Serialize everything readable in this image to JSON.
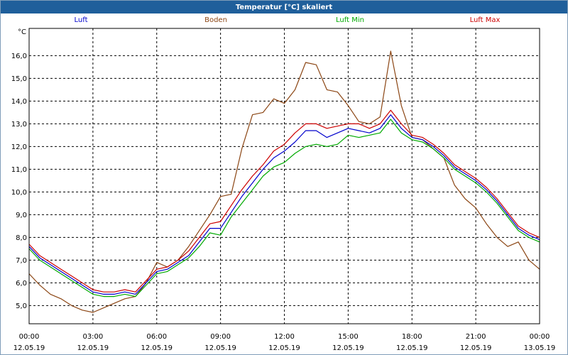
{
  "chart_data": {
    "type": "line",
    "title": "Temperatur [°C] skaliert",
    "yunit": "°C",
    "ylim": [
      4.2,
      17.2
    ],
    "yticks": [
      "5,0",
      "6,0",
      "7,0",
      "8,0",
      "9,0",
      "10,0",
      "11,0",
      "12,0",
      "13,0",
      "14,0",
      "15,0",
      "16,0"
    ],
    "yticks_values": [
      5,
      6,
      7,
      8,
      9,
      10,
      11,
      12,
      13,
      14,
      15,
      16
    ],
    "xlim": [
      0,
      24
    ],
    "xticks": [
      {
        "time": "00:00",
        "date": "12.05.19"
      },
      {
        "time": "03:00",
        "date": "12.05.19"
      },
      {
        "time": "06:00",
        "date": "12.05.19"
      },
      {
        "time": "09:00",
        "date": "12.05.19"
      },
      {
        "time": "12:00",
        "date": "12.05.19"
      },
      {
        "time": "15:00",
        "date": "12.05.19"
      },
      {
        "time": "18:00",
        "date": "12.05.19"
      },
      {
        "time": "21:00",
        "date": "12.05.19"
      },
      {
        "time": "00:00",
        "date": "13.05.19"
      }
    ],
    "grid": true,
    "series": [
      {
        "name": "Luft",
        "color": "#0000cc",
        "x": [
          0,
          0.5,
          1,
          1.5,
          2,
          2.5,
          3,
          3.5,
          4,
          4.5,
          5,
          5.5,
          6,
          6.5,
          7,
          7.5,
          8,
          8.5,
          9,
          9.5,
          10,
          10.5,
          11,
          11.5,
          12,
          12.5,
          13,
          13.5,
          14,
          14.5,
          15,
          15.5,
          16,
          16.5,
          17,
          17.5,
          18,
          18.5,
          19,
          19.5,
          20,
          20.5,
          21,
          21.5,
          22,
          22.5,
          23,
          23.5,
          24
        ],
        "values": [
          7.6,
          7.1,
          6.8,
          6.5,
          6.2,
          5.9,
          5.6,
          5.5,
          5.5,
          5.6,
          5.5,
          6.0,
          6.5,
          6.6,
          6.9,
          7.2,
          7.8,
          8.4,
          8.4,
          9.1,
          9.8,
          10.4,
          11.0,
          11.5,
          11.8,
          12.2,
          12.7,
          12.7,
          12.4,
          12.6,
          12.8,
          12.7,
          12.6,
          12.8,
          13.4,
          12.8,
          12.4,
          12.3,
          12.0,
          11.6,
          11.1,
          10.8,
          10.5,
          10.1,
          9.6,
          9.0,
          8.4,
          8.1,
          7.9
        ]
      },
      {
        "name": "Boden",
        "color": "#8b4513",
        "x": [
          0,
          0.5,
          1,
          1.5,
          2,
          2.5,
          3,
          3.5,
          4,
          4.5,
          5,
          5.5,
          6,
          6.5,
          7,
          7.5,
          8,
          8.5,
          9,
          9.5,
          10,
          10.5,
          11,
          11.5,
          12,
          12.5,
          13,
          13.5,
          14,
          14.5,
          15,
          15.5,
          16,
          16.5,
          17,
          17.5,
          18,
          18.5,
          19,
          19.5,
          20,
          20.5,
          21,
          21.5,
          22,
          22.5,
          23,
          23.5,
          24
        ],
        "values": [
          6.4,
          5.9,
          5.5,
          5.3,
          5.0,
          4.8,
          4.7,
          4.9,
          5.1,
          5.3,
          5.4,
          6.0,
          6.9,
          6.7,
          7.0,
          7.6,
          8.3,
          9.0,
          9.8,
          9.9,
          11.9,
          13.4,
          13.5,
          14.1,
          13.9,
          14.5,
          15.7,
          15.6,
          14.5,
          14.4,
          13.8,
          13.1,
          13.0,
          13.3,
          16.2,
          13.8,
          12.4,
          12.3,
          11.9,
          11.5,
          10.3,
          9.7,
          9.3,
          8.6,
          8.0,
          7.6,
          7.8,
          7.0,
          6.6
        ]
      },
      {
        "name": "Luft Min",
        "color": "#00aa00",
        "x": [
          0,
          0.5,
          1,
          1.5,
          2,
          2.5,
          3,
          3.5,
          4,
          4.5,
          5,
          5.5,
          6,
          6.5,
          7,
          7.5,
          8,
          8.5,
          9,
          9.5,
          10,
          10.5,
          11,
          11.5,
          12,
          12.5,
          13,
          13.5,
          14,
          14.5,
          15,
          15.5,
          16,
          16.5,
          17,
          17.5,
          18,
          18.5,
          19,
          19.5,
          20,
          20.5,
          21,
          21.5,
          22,
          22.5,
          23,
          23.5,
          24
        ],
        "values": [
          7.5,
          7.0,
          6.7,
          6.4,
          6.1,
          5.8,
          5.5,
          5.4,
          5.4,
          5.5,
          5.4,
          5.9,
          6.4,
          6.5,
          6.8,
          7.1,
          7.6,
          8.2,
          8.1,
          8.9,
          9.5,
          10.1,
          10.7,
          11.1,
          11.3,
          11.7,
          12.0,
          12.1,
          12.0,
          12.1,
          12.5,
          12.4,
          12.5,
          12.6,
          13.2,
          12.6,
          12.3,
          12.2,
          11.9,
          11.5,
          11.0,
          10.7,
          10.4,
          10.0,
          9.5,
          8.9,
          8.3,
          8.0,
          7.8
        ]
      },
      {
        "name": "Luft Max",
        "color": "#cc0000",
        "x": [
          0,
          0.5,
          1,
          1.5,
          2,
          2.5,
          3,
          3.5,
          4,
          4.5,
          5,
          5.5,
          6,
          6.5,
          7,
          7.5,
          8,
          8.5,
          9,
          9.5,
          10,
          10.5,
          11,
          11.5,
          12,
          12.5,
          13,
          13.5,
          14,
          14.5,
          15,
          15.5,
          16,
          16.5,
          17,
          17.5,
          18,
          18.5,
          19,
          19.5,
          20,
          20.5,
          21,
          21.5,
          22,
          22.5,
          23,
          23.5,
          24
        ],
        "values": [
          7.7,
          7.2,
          6.9,
          6.6,
          6.3,
          6.0,
          5.7,
          5.6,
          5.6,
          5.7,
          5.6,
          6.1,
          6.6,
          6.7,
          7.0,
          7.4,
          8.0,
          8.6,
          8.7,
          9.4,
          10.1,
          10.7,
          11.2,
          11.8,
          12.1,
          12.6,
          13.0,
          13.0,
          12.8,
          12.9,
          13.0,
          13.0,
          12.8,
          13.0,
          13.6,
          13.0,
          12.5,
          12.4,
          12.1,
          11.7,
          11.2,
          10.9,
          10.6,
          10.2,
          9.7,
          9.1,
          8.5,
          8.2,
          8.0
        ]
      }
    ]
  }
}
